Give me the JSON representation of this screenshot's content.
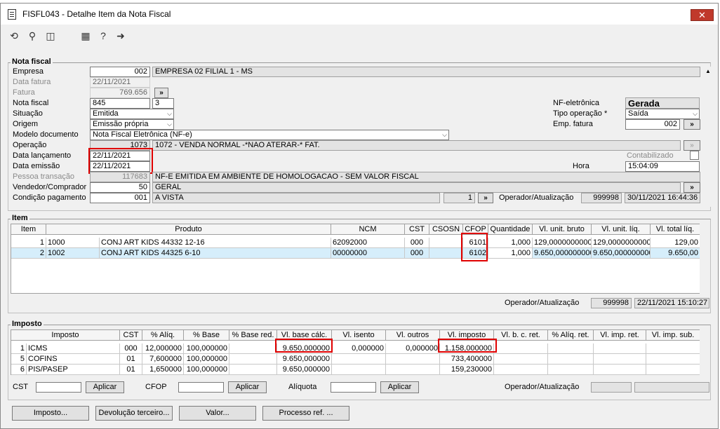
{
  "window": {
    "title": "FISFL043 - Detalhe Item da Nota Fiscal",
    "close_label": "✕"
  },
  "toolbar": {
    "icons": [
      "undo-icon",
      "search-icon",
      "save-icon",
      "calendar-icon",
      "help-icon",
      "exit-icon"
    ]
  },
  "nota": {
    "group_title": "Nota fiscal",
    "empresa_label": "Empresa",
    "empresa_code": "002",
    "empresa_name": "EMPRESA 02 FILIAL 1 - MS",
    "data_fatura_label": "Data fatura",
    "data_fatura": "22/11/2021",
    "fatura_label": "Fatura",
    "fatura": "769.656",
    "fatura_btn": "»",
    "nota_fiscal_label": "Nota fiscal",
    "nota_fiscal": "845",
    "nota_serie": "3",
    "situacao_label": "Situação",
    "situacao": "Emitida",
    "origem_label": "Origem",
    "origem": "Emissão própria",
    "modelo_label": "Modelo documento",
    "modelo": "Nota Fiscal Eletrônica (NF-e)",
    "operacao_label": "Operação",
    "operacao_code": "1073",
    "operacao_desc": "1072 - VENDA NORMAL -*NAO ATERAR-* FAT.",
    "data_lanc_label": "Data lançamento",
    "data_lanc": "22/11/2021",
    "data_emissao_label": "Data emissão",
    "data_emissao": "22/11/2021",
    "pessoa_label": "Pessoa transação",
    "pessoa_code": "117683",
    "pessoa_desc": "NF-E EMITIDA EM AMBIENTE DE HOMOLOGACAO - SEM VALOR FISCAL",
    "vendedor_label": "Vendedor/Comprador",
    "vendedor_code": "50",
    "vendedor_desc": "GERAL",
    "condicao_label": "Condição pagamento",
    "condicao_code": "001",
    "condicao_desc": "A VISTA",
    "condicao_parcelas": "1",
    "nfe_label": "NF-eletrônica",
    "nfe_status": "Gerada",
    "tipo_op_label": "Tipo operação *",
    "tipo_op": "Saída",
    "emp_fatura_label": "Emp. fatura",
    "emp_fatura": "002",
    "contabilizado_label": "Contabilizado",
    "hora_label": "Hora",
    "hora": "15:04:09",
    "operador_label": "Operador/Atualização",
    "operador_code": "999998",
    "operador_dt": "30/11/2021 16:44:36"
  },
  "item": {
    "group_title": "Item",
    "columns": [
      "Item",
      "Produto",
      "NCM",
      "CST",
      "CSOSN",
      "CFOP",
      "Quantidade",
      "Vl. unit. bruto",
      "Vl. unit. líq.",
      "Vl. total líq."
    ],
    "rows": [
      {
        "item": "1",
        "code": "1000",
        "produto": "CONJ ART KIDS 44332 12-16",
        "ncm": "62092000",
        "cst": "000",
        "csosn": "",
        "cfop": "6101",
        "qtd": "1,000",
        "bruto": "129,0000000000",
        "liq": "129,0000000000",
        "total": "129,00"
      },
      {
        "item": "2",
        "code": "1002",
        "produto": "CONJ ART KIDS 44325 6-10",
        "ncm": "00000000",
        "cst": "000",
        "csosn": "",
        "cfop": "6102",
        "qtd": "1,000",
        "bruto": "9.650,000000000",
        "liq": "9.650,000000000",
        "total": "9.650,00"
      }
    ],
    "operador_label": "Operador/Atualização",
    "operador_code": "999998",
    "operador_dt": "22/11/2021 15:10:27"
  },
  "imposto": {
    "group_title": "Imposto",
    "columns": [
      "Imposto",
      "CST",
      "% Alíq.",
      "% Base",
      "% Base red.",
      "Vl. base cálc.",
      "Vl. isento",
      "Vl. outros",
      "Vl. imposto",
      "Vl. b. c. ret.",
      "% Alíq. ret.",
      "Vl. imp. ret.",
      "Vl. imp. sub."
    ],
    "rows": [
      {
        "n": "1",
        "imposto": "ICMS",
        "cst": "000",
        "aliq": "12,000000",
        "base": "100,000000",
        "basered": "",
        "vlbase": "9.650,000000",
        "isento": "0,000000",
        "outros": "0,000000",
        "vlimp": "1.158,000000"
      },
      {
        "n": "5",
        "imposto": "COFINS",
        "cst": "01",
        "aliq": "7,600000",
        "base": "100,000000",
        "basered": "",
        "vlbase": "9.650,000000",
        "isento": "",
        "outros": "",
        "vlimp": "733,400000"
      },
      {
        "n": "6",
        "imposto": "PIS/PASEP",
        "cst": "01",
        "aliq": "1,650000",
        "base": "100,000000",
        "basered": "",
        "vlbase": "9.650,000000",
        "isento": "",
        "outros": "",
        "vlimp": "159,230000"
      }
    ],
    "cst_label": "CST",
    "cfop_label": "CFOP",
    "aliquota_label": "Alíquota",
    "aplicar": "Aplicar",
    "operador_label": "Operador/Atualização"
  },
  "footer": {
    "btn_imposto": "Imposto...",
    "btn_devolucao": "Devolução terceiro...",
    "btn_valor": "Valor...",
    "btn_processo": "Processo ref. ..."
  }
}
